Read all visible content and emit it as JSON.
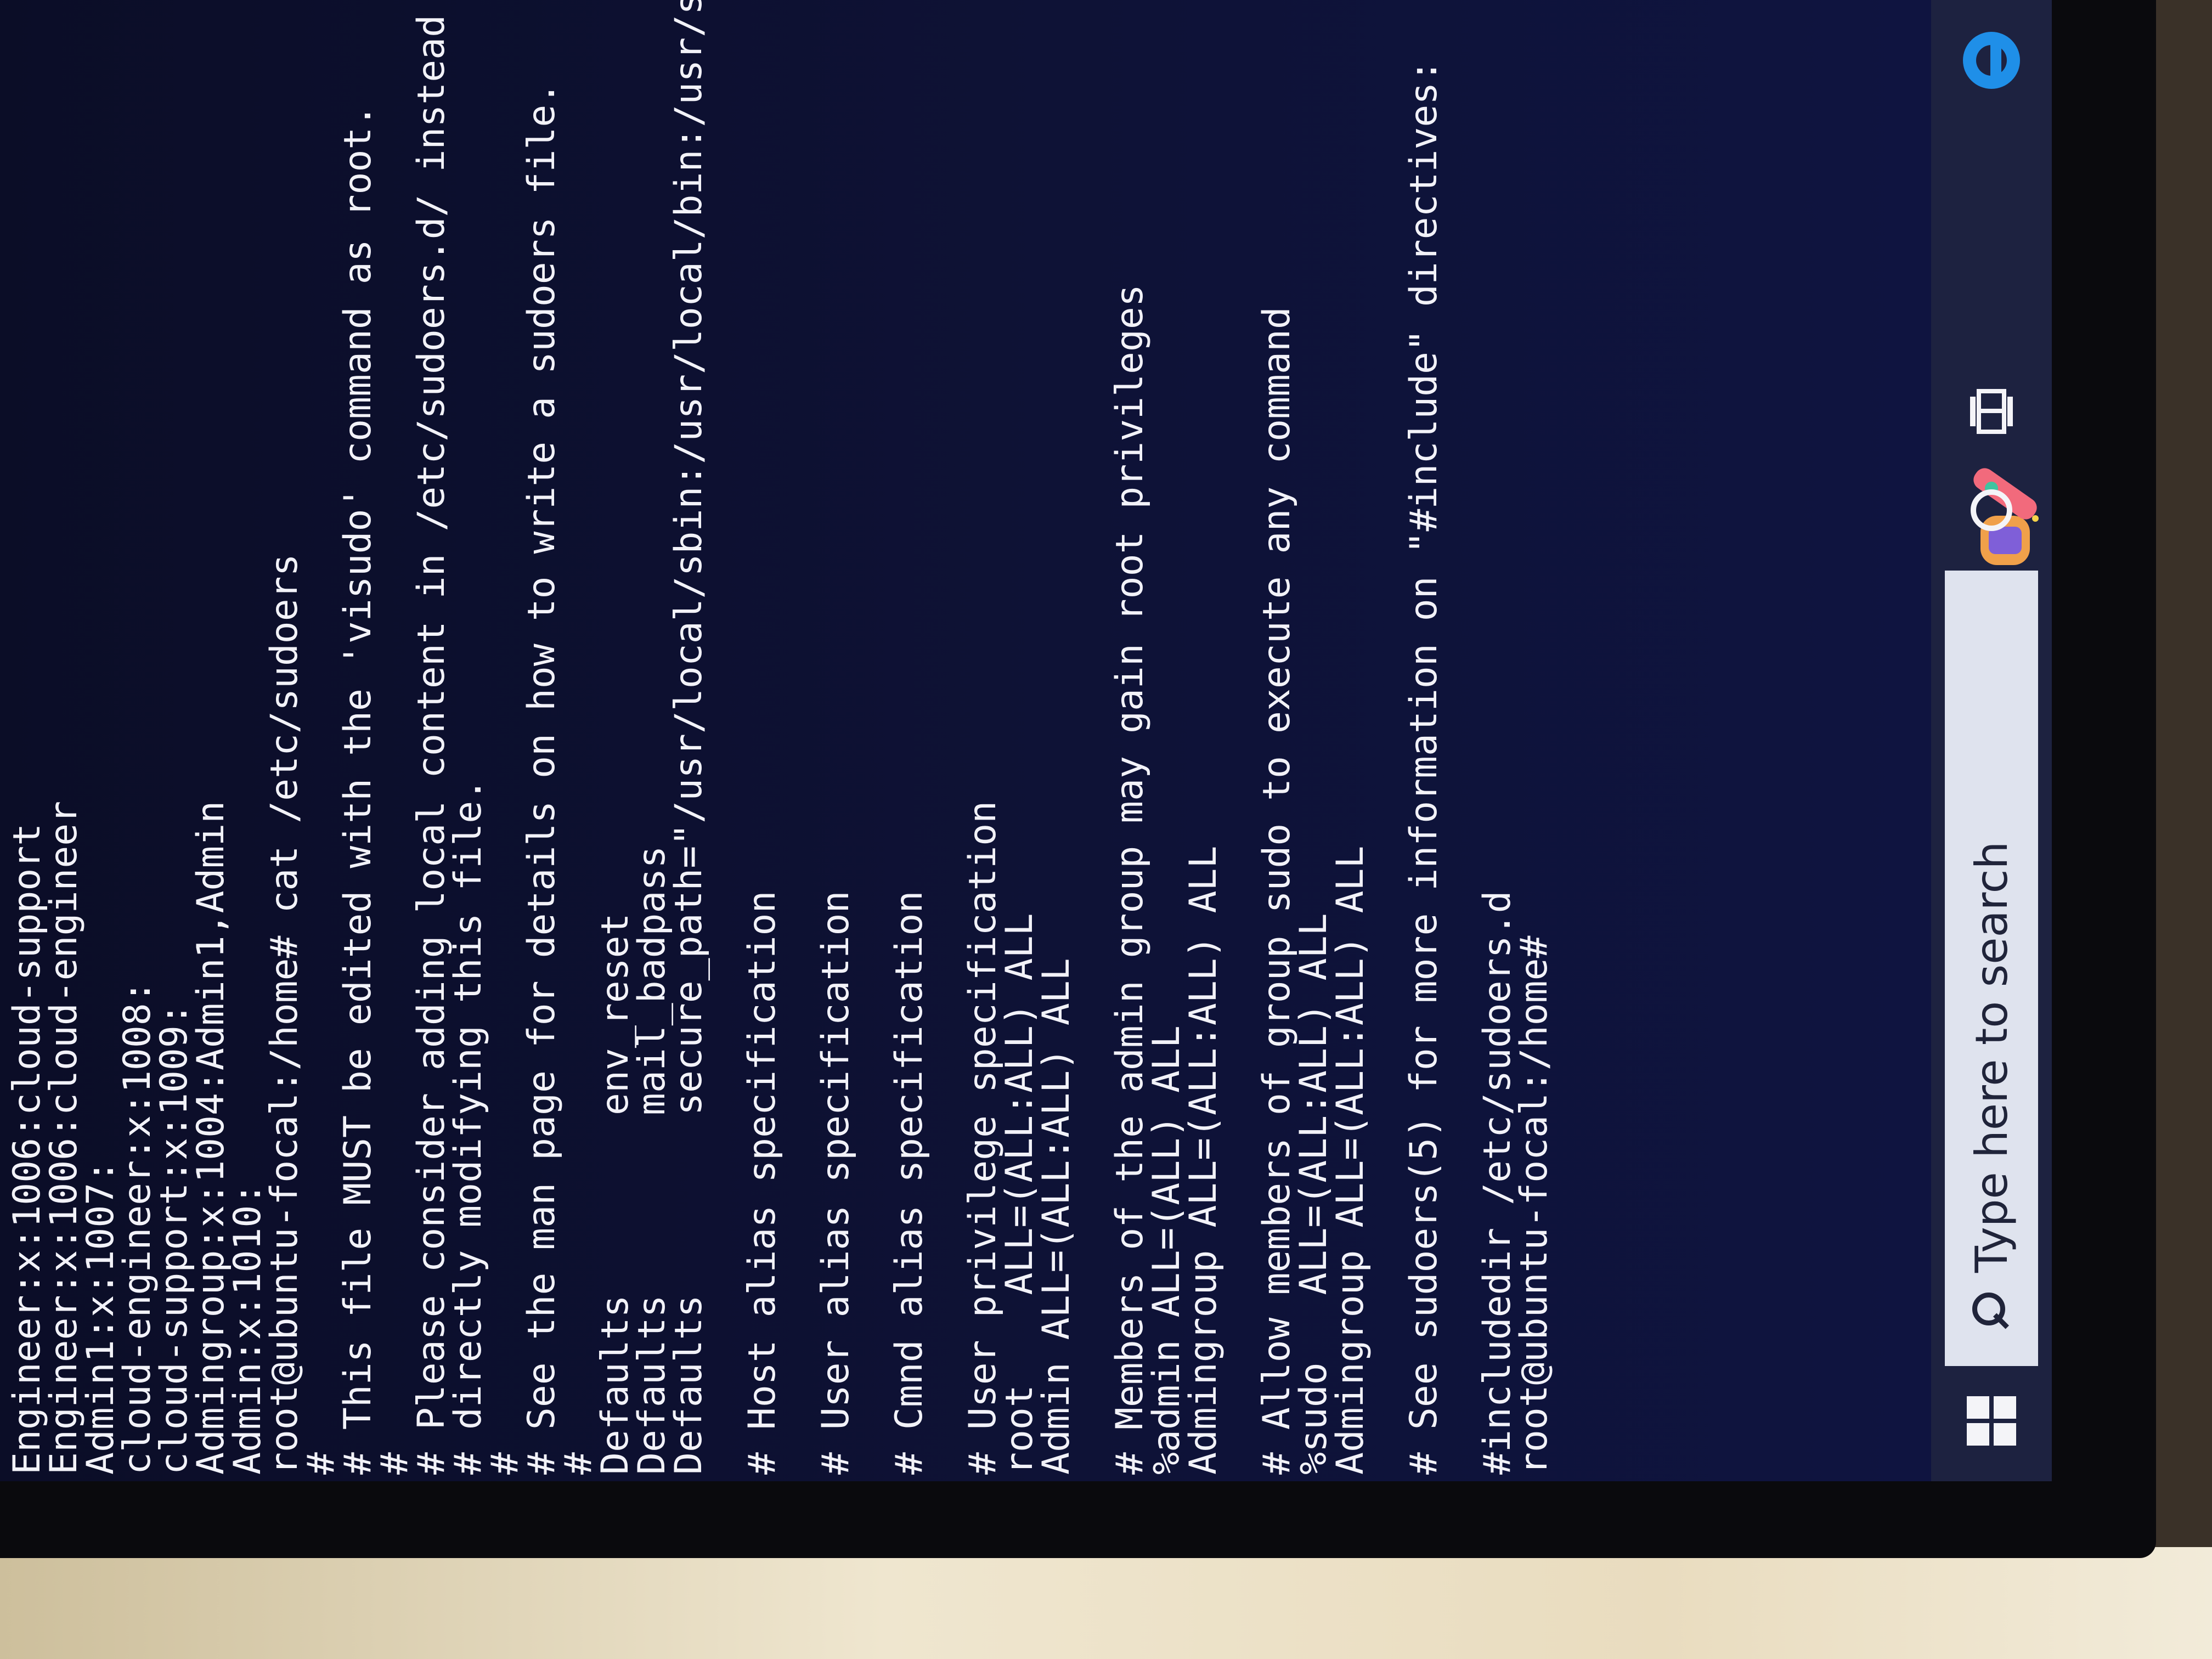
{
  "terminal": {
    "lines": [
      "Engineer:x:1006:cloud-support",
      "Engineer:x:1006:cloud-engineer",
      "Admin1:x:1007:",
      "cloud-engineer:x:1008:",
      "cloud-support:x:1009:",
      "Admingroup:x:1004:Admin1,Admin",
      "Admin:x:1010:",
      "root@ubuntu-focal:/home# cat /etc/sudoers",
      "#",
      "# This file MUST be edited with the 'visudo' command as root.",
      "#",
      "# Please consider adding local content in /etc/sudoers.d/ instead of",
      "# directly modifying this file.",
      "#",
      "# See the man page for details on how to write a sudoers file.",
      "#",
      "Defaults        env_reset",
      "Defaults        mail_badpass",
      "Defaults        secure_path=\"/usr/local/sbin:/usr/local/bin:/usr/sbin",
      "",
      "# Host alias specification",
      "",
      "# User alias specification",
      "",
      "# Cmnd alias specification",
      "",
      "# User privilege specification",
      "root    ALL=(ALL:ALL) ALL",
      "Admin ALL=(ALL:ALL) ALL",
      "",
      "# Members of the admin group may gain root privileges",
      "%admin ALL=(ALL) ALL",
      "Admingroup ALL=(ALL:ALL) ALL",
      "",
      "# Allow members of group sudo to execute any command",
      "%sudo   ALL=(ALL:ALL) ALL",
      "Admingroup ALL=(ALL:ALL) ALL",
      "",
      "# See sudoers(5) for more information on \"#include\" directives:",
      "",
      "#includedir /etc/sudoers.d",
      "root@ubuntu-focal:/home#"
    ]
  },
  "taskbar": {
    "search_placeholder": "Type here to search",
    "start_icon": "windows-logo-icon",
    "cortana_icon": "cortana-circle-icon",
    "taskview_icon": "task-view-icon",
    "edge_icon": "edge-browser-icon"
  }
}
